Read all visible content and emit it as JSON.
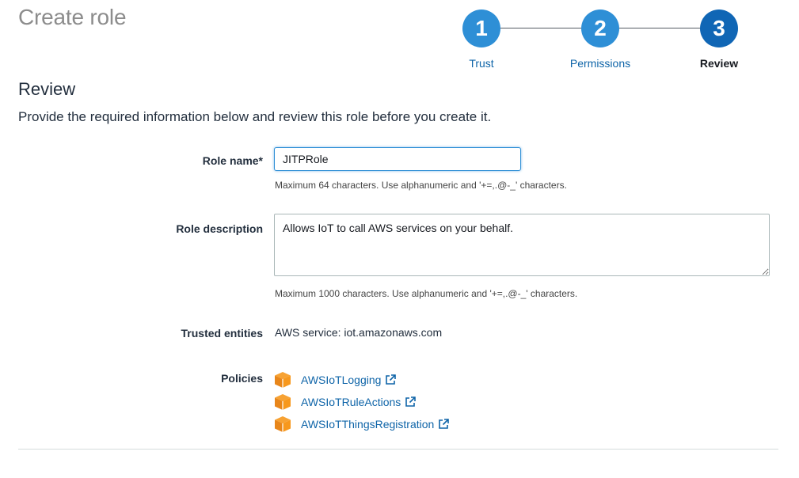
{
  "page": {
    "title": "Create role"
  },
  "stepper": {
    "steps": [
      {
        "number": "1",
        "label": "Trust",
        "active": false
      },
      {
        "number": "2",
        "label": "Permissions",
        "active": false
      },
      {
        "number": "3",
        "label": "Review",
        "active": true
      }
    ]
  },
  "review": {
    "heading": "Review",
    "intro": "Provide the required information below and review this role before you create it."
  },
  "form": {
    "role_name": {
      "label": "Role name*",
      "value": "JITPRole",
      "hint": "Maximum 64 characters. Use alphanumeric and '+=,.@-_' characters."
    },
    "role_description": {
      "label": "Role description",
      "value": "Allows IoT to call AWS services on your behalf.",
      "hint": "Maximum 1000 characters. Use alphanumeric and '+=,.@-_' characters."
    },
    "trusted_entities": {
      "label": "Trusted entities",
      "value": "AWS service: iot.amazonaws.com"
    },
    "policies": {
      "label": "Policies",
      "items": [
        {
          "name": "AWSIoTLogging"
        },
        {
          "name": "AWSIoTRuleActions"
        },
        {
          "name": "AWSIoTThingsRegistration"
        }
      ]
    }
  },
  "colors": {
    "step_circle": "#2e8fd6",
    "step_circle_active": "#1066b5",
    "link": "#0e64a8",
    "policy_icon": "#f7981d"
  },
  "icons": {
    "policy": "policy-cube-icon",
    "external": "external-link-icon"
  }
}
